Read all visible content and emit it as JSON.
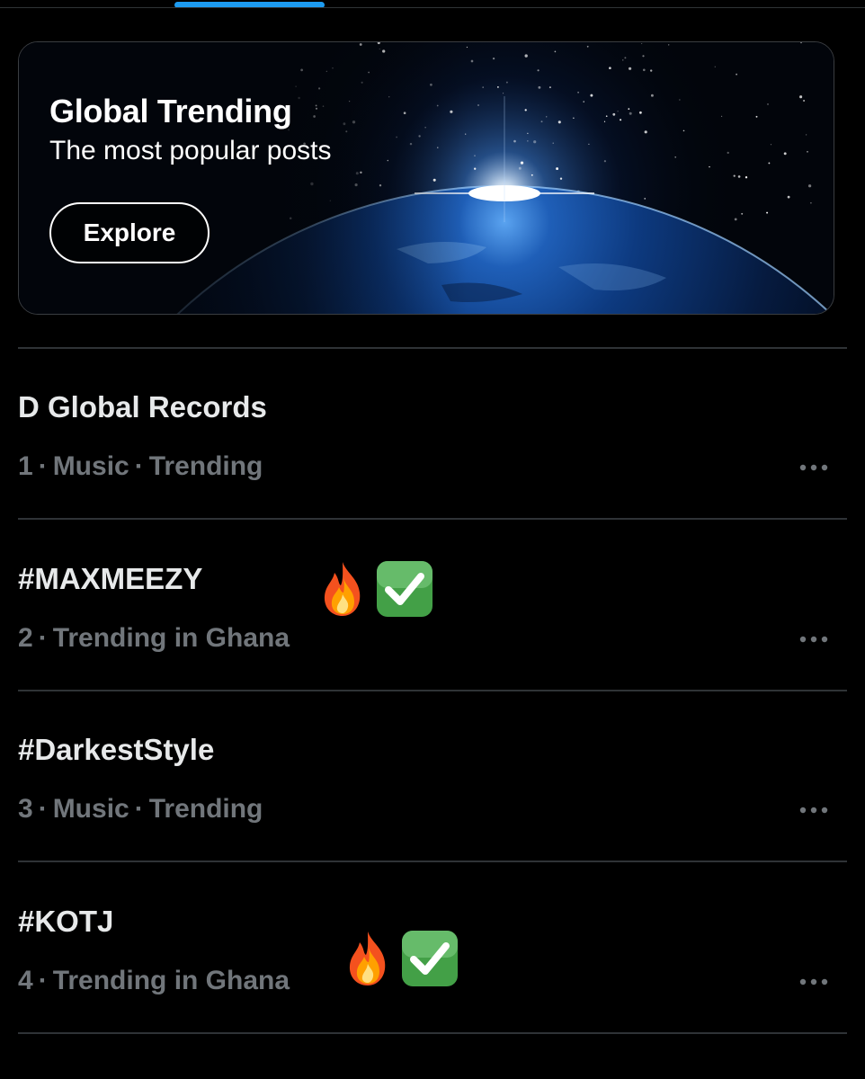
{
  "banner": {
    "title": "Global Trending",
    "subtitle": "The most popular posts",
    "button_label": "Explore"
  },
  "trends": [
    {
      "name": "D Global Records",
      "rank": "1",
      "context": [
        "Music",
        "Trending"
      ],
      "separator": "·",
      "emoji": []
    },
    {
      "name": "#MAXMEEZY",
      "rank": "2",
      "context": [
        "Trending in Ghana"
      ],
      "separator": "·",
      "emoji": [
        "fire-icon",
        "check-mark-button-icon"
      ]
    },
    {
      "name": "#DarkestStyle",
      "rank": "3",
      "context": [
        "Music",
        "Trending"
      ],
      "separator": "·",
      "emoji": []
    },
    {
      "name": "#KOTJ",
      "rank": "4",
      "context": [
        "Trending in Ghana"
      ],
      "separator": "·",
      "emoji": [
        "fire-icon",
        "check-mark-button-icon"
      ]
    }
  ],
  "colors": {
    "background": "#000000",
    "accent": "#1d9bf0",
    "primary_text": "#e7e9ea",
    "secondary_text": "#71767b",
    "divider": "#2f3336"
  }
}
